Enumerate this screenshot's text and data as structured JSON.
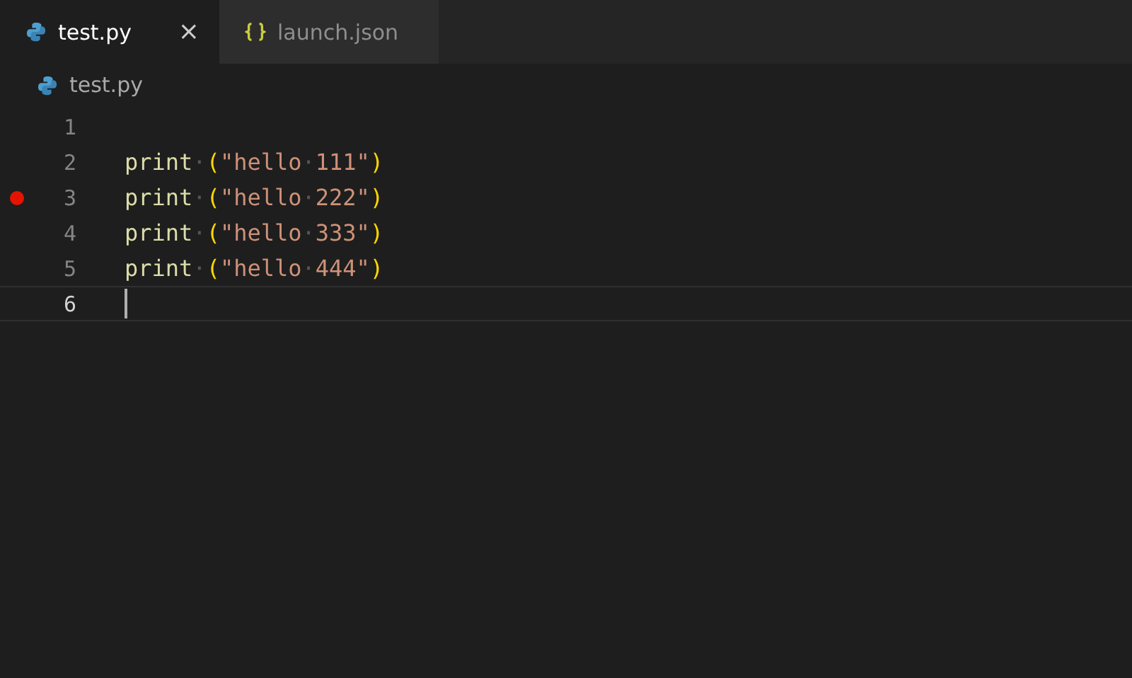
{
  "tabs": [
    {
      "label": "test.py",
      "kind": "python",
      "selected": true,
      "close": "×"
    },
    {
      "label": "launch.json",
      "kind": "json",
      "selected": false
    }
  ],
  "breadcrumb": {
    "kind": "python",
    "label": "test.py"
  },
  "lines": [
    {
      "number": "1",
      "breakpoint": false,
      "current": false
    },
    {
      "number": "2",
      "breakpoint": false,
      "current": false,
      "tokens": [
        {
          "kind": "fn",
          "text": "print"
        },
        {
          "kind": "ws",
          "text": "·"
        },
        {
          "kind": "paren",
          "text": "("
        },
        {
          "kind": "str",
          "text": "\"hello"
        },
        {
          "kind": "ws",
          "text": "·"
        },
        {
          "kind": "str",
          "text": "111\""
        },
        {
          "kind": "paren",
          "text": ")"
        }
      ]
    },
    {
      "number": "3",
      "breakpoint": true,
      "current": false,
      "tokens": [
        {
          "kind": "fn",
          "text": "print"
        },
        {
          "kind": "ws",
          "text": "·"
        },
        {
          "kind": "paren",
          "text": "("
        },
        {
          "kind": "str",
          "text": "\"hello"
        },
        {
          "kind": "ws",
          "text": "·"
        },
        {
          "kind": "str",
          "text": "222\""
        },
        {
          "kind": "paren",
          "text": ")"
        }
      ]
    },
    {
      "number": "4",
      "breakpoint": false,
      "current": false,
      "tokens": [
        {
          "kind": "fn",
          "text": "print"
        },
        {
          "kind": "ws",
          "text": "·"
        },
        {
          "kind": "paren",
          "text": "("
        },
        {
          "kind": "str",
          "text": "\"hello"
        },
        {
          "kind": "ws",
          "text": "·"
        },
        {
          "kind": "str",
          "text": "333\""
        },
        {
          "kind": "paren",
          "text": ")"
        }
      ]
    },
    {
      "number": "5",
      "breakpoint": false,
      "current": false,
      "tokens": [
        {
          "kind": "fn",
          "text": "print"
        },
        {
          "kind": "ws",
          "text": "·"
        },
        {
          "kind": "paren",
          "text": "("
        },
        {
          "kind": "str",
          "text": "\"hello"
        },
        {
          "kind": "ws",
          "text": "·"
        },
        {
          "kind": "str",
          "text": "444\""
        },
        {
          "kind": "paren",
          "text": ")"
        }
      ]
    },
    {
      "number": "6",
      "breakpoint": false,
      "current": true
    }
  ]
}
